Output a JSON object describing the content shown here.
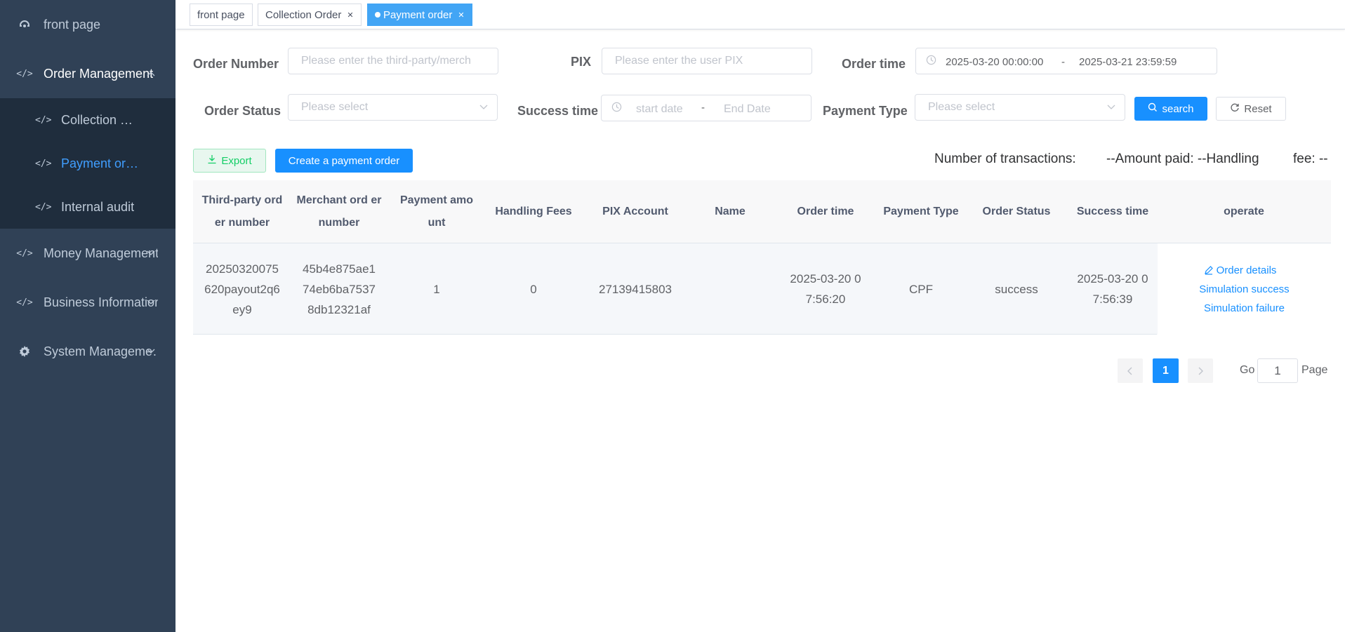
{
  "sidebar": {
    "items": [
      {
        "label": "front page",
        "icon": "dashboard-icon"
      },
      {
        "label": "Order Management",
        "icon": "code-icon"
      },
      {
        "label": "Money Management",
        "icon": "code-icon"
      },
      {
        "label": "Business Information",
        "icon": "code-icon"
      },
      {
        "label": "System Manageme…",
        "icon": "gear-icon"
      }
    ],
    "subitems": [
      {
        "label": "Collection …"
      },
      {
        "label": "Payment or…"
      },
      {
        "label": "Internal audit"
      }
    ]
  },
  "tags": [
    {
      "label": "front page"
    },
    {
      "label": "Collection Order"
    },
    {
      "label": "Payment order"
    }
  ],
  "filters": {
    "order_number": {
      "label": "Order Number",
      "placeholder": "Please enter the third-party/merch"
    },
    "pix": {
      "label": "PIX",
      "placeholder": "Please enter the user PIX"
    },
    "order_time": {
      "label": "Order time",
      "start": "2025-03-20 00:00:00",
      "separator": "-",
      "end": "2025-03-21 23:59:59"
    },
    "order_status": {
      "label": "Order Status",
      "placeholder": "Please select"
    },
    "success_time": {
      "label": "Success time",
      "start_placeholder": "start date",
      "separator": "-",
      "end_placeholder": "End Date"
    },
    "payment_type": {
      "label": "Payment Type",
      "placeholder": "Please select"
    }
  },
  "buttons": {
    "search": "search",
    "reset": "Reset",
    "export": "Export",
    "create": "Create a payment order"
  },
  "summary": {
    "transactions": "Number of transactions:",
    "amount": "--Amount paid: --Handling",
    "fee": "fee: --"
  },
  "table": {
    "headers": [
      "Third-party ord er number",
      "Merchant ord er number",
      "Payment amo unt",
      "Handling Fees",
      "PIX Account",
      "Name",
      "Order time",
      "Payment Type",
      "Order Status",
      "Success time",
      "operate"
    ],
    "rows": [
      {
        "third_party": "20250320075620payout2q6ey9",
        "merchant": "45b4e875ae174eb6ba75378db12321af",
        "amount": "1",
        "fee": "0",
        "pix": "27139415803",
        "name": "",
        "order_time": "2025-03-20 07:56:20",
        "payment_type": "CPF",
        "status": "success",
        "success_time": "2025-03-20 07:56:39",
        "ops": [
          "Order details",
          "Simulation success",
          "Simulation failure"
        ]
      }
    ]
  },
  "pagination": {
    "current": "1",
    "go_label": "Go",
    "go_value": "1",
    "page_label": "Page"
  },
  "colors": {
    "sidebar_bg": "#304156",
    "submenu_bg": "#1f2d3d",
    "primary": "#1890ff",
    "active_tag": "#42a5f5"
  }
}
